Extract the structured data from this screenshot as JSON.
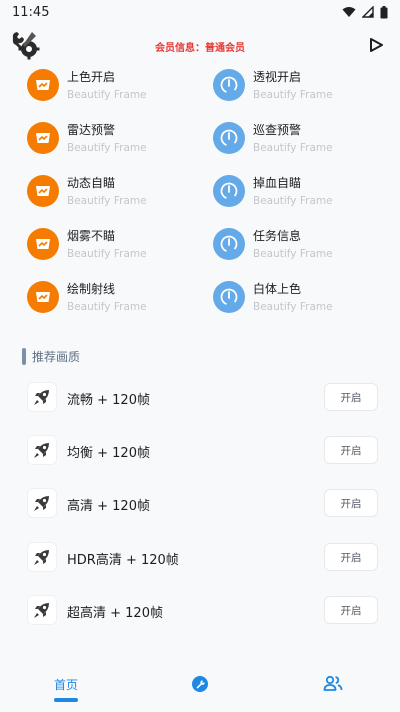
{
  "status_bar": {
    "time": "11:45"
  },
  "topbar": {
    "member_info": "会员信息：普通会员"
  },
  "features": [
    {
      "title": "上色开启",
      "subtitle": "Beautify Frame",
      "icon": "card-icon",
      "color": "#f57c00"
    },
    {
      "title": "透视开启",
      "subtitle": "Beautify Frame",
      "icon": "gauge-icon",
      "color": "#64a9e8"
    },
    {
      "title": "雷达预警",
      "subtitle": "Beautify Frame",
      "icon": "card-icon",
      "color": "#f57c00"
    },
    {
      "title": "巡查预警",
      "subtitle": "Beautify Frame",
      "icon": "gauge-icon",
      "color": "#64a9e8"
    },
    {
      "title": "动态自瞄",
      "subtitle": "Beautify Frame",
      "icon": "card-icon",
      "color": "#f57c00"
    },
    {
      "title": "掉血自瞄",
      "subtitle": "Beautify Frame",
      "icon": "gauge-icon",
      "color": "#64a9e8"
    },
    {
      "title": "烟雾不瞄",
      "subtitle": "Beautify Frame",
      "icon": "card-icon",
      "color": "#f57c00"
    },
    {
      "title": "任务信息",
      "subtitle": "Beautify Frame",
      "icon": "gauge-icon",
      "color": "#64a9e8"
    },
    {
      "title": "绘制射线",
      "subtitle": "Beautify Frame",
      "icon": "card-icon",
      "color": "#f57c00"
    },
    {
      "title": "白体上色",
      "subtitle": "Beautify Frame",
      "icon": "gauge-icon",
      "color": "#64a9e8"
    }
  ],
  "section": {
    "title": "推荐画质"
  },
  "quality_options": [
    {
      "label": "流畅 + 120帧",
      "button": "开启",
      "icon": "rocket-icon"
    },
    {
      "label": "均衡 + 120帧",
      "button": "开启",
      "icon": "rocket-icon"
    },
    {
      "label": "高清 + 120帧",
      "button": "开启",
      "icon": "rocket-icon"
    },
    {
      "label": "HDR高清 + 120帧",
      "button": "开启",
      "icon": "rocket-icon"
    },
    {
      "label": "超高清 + 120帧",
      "button": "开启",
      "icon": "rocket-icon"
    }
  ],
  "bottom_nav": {
    "home": "首页"
  },
  "colors": {
    "accent": "#1e88e5",
    "member": "#e53935",
    "orange": "#f57c00",
    "blue": "#64a9e8"
  }
}
